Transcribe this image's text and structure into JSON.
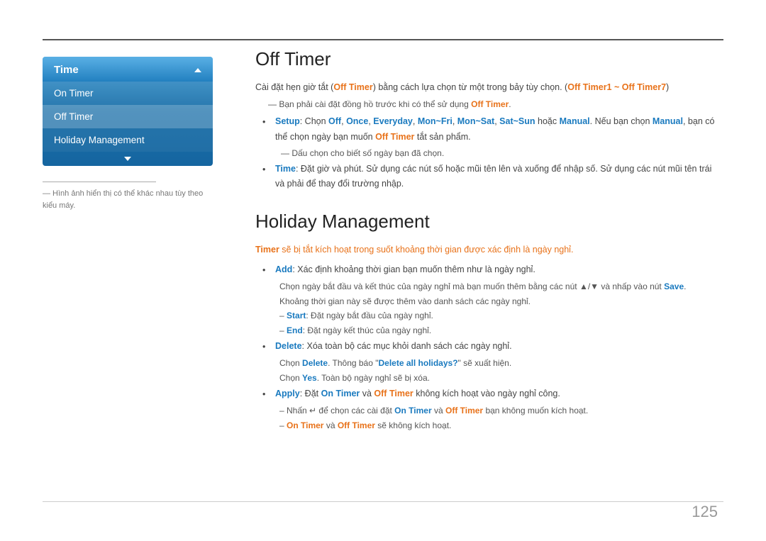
{
  "page": {
    "number": "125",
    "top_line": true
  },
  "sidebar": {
    "header": "Time",
    "arrow_up": "▲",
    "arrow_down": "▼",
    "items": [
      {
        "label": "On Timer",
        "active": false
      },
      {
        "label": "Off Timer",
        "active": true
      },
      {
        "label": "Holiday Management",
        "active": false
      }
    ],
    "note": "— Hình ảnh hiển thị có thể khác nhau tùy theo kiểu máy."
  },
  "off_timer": {
    "title": "Off Timer",
    "intro": "Cài đặt hẹn giờ tắt (Off Timer) bằng cách lựa chọn từ một trong bảy tùy chọn. (Off Timer1 ~ Off Timer7)",
    "note1": "Bạn phải cài đặt đồng hồ trước khi có thể sử dụng Off Timer.",
    "bullet1_label": "Setup",
    "bullet1_text": ": Chọn Off, Once, Everyday, Mon~Fri, Mon~Sat, Sat~Sun hoặc Manual. Nếu bạn chọn Manual, bạn có thể chọn ngày bạn muốn Off Timer tắt sản phẩm.",
    "bullet1_sub": "Dấu chọn cho biết số ngày bạn đã chọn.",
    "bullet2_label": "Time",
    "bullet2_text": ": Đặt giờ và phút. Sử dụng các nút số hoặc mũi tên lên và xuống để nhập số. Sử dụng các nút mũi tên trái và phải để thay đổi trường nhập."
  },
  "holiday_management": {
    "title": "Holiday Management",
    "intro": "Timer sẽ bị tắt kích hoạt trong suốt khoảng thời gian được xác định là ngày nghỉ.",
    "add_label": "Add",
    "add_text": ": Xác định khoảng thời gian bạn muốn thêm như là ngày nghỉ.",
    "add_sub1": "Chọn ngày bắt đầu và kết thúc của ngày nghỉ mà bạn muốn thêm bằng các nút ▲/▼ và nhấp vào nút Save.",
    "add_sub2": "Khoảng thời gian này sẽ được thêm vào danh sách các ngày nghỉ.",
    "start_label": "Start",
    "start_text": ": Đặt ngày bắt đầu của ngày nghỉ.",
    "end_label": "End",
    "end_text": ": Đặt ngày kết thúc của ngày nghỉ.",
    "delete_label": "Delete",
    "delete_text": ": Xóa toàn bộ các mục khỏi danh sách các ngày nghỉ.",
    "delete_sub1": "Chọn Delete. Thông báo \"Delete all holidays?\" sẽ xuất hiện.",
    "delete_sub2": "Chọn Yes. Toàn bộ ngày nghỉ sẽ bị xóa.",
    "apply_label": "Apply",
    "apply_text": ": Đặt On Timer và Off Timer không kích hoạt vào ngày nghỉ công.",
    "apply_sub1": "Nhấn ↵ để chọn các cài đặt On Timer và Off Timer bạn không muốn kích hoạt.",
    "apply_sub2": "On Timer và Off Timer sẽ không kích hoạt."
  }
}
